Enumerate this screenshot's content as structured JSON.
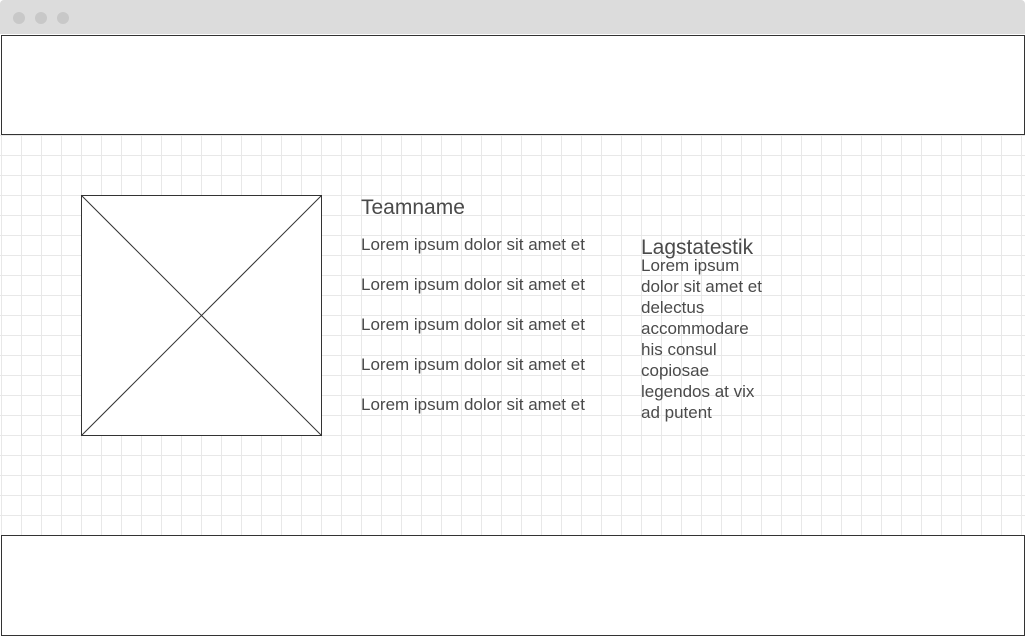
{
  "team": {
    "name": "Teamname",
    "lines": [
      "Lorem ipsum dolor sit amet et",
      "Lorem ipsum dolor sit amet et",
      "Lorem ipsum dolor sit amet et",
      "Lorem ipsum dolor sit amet et",
      "Lorem ipsum dolor sit amet et"
    ]
  },
  "stats": {
    "title": "Lagstatestik",
    "text": "Lorem ipsum dolor sit amet et delectus accommodare his consul copiosae legendos at vix ad putent"
  },
  "icons": {
    "image_placeholder": "image-placeholder-icon"
  },
  "colors": {
    "titlebar": "#dcdcdc",
    "window_dot": "#c8c8c8",
    "border": "#333333",
    "grid_line": "#e8e8e8",
    "text": "#4a4a4a"
  }
}
